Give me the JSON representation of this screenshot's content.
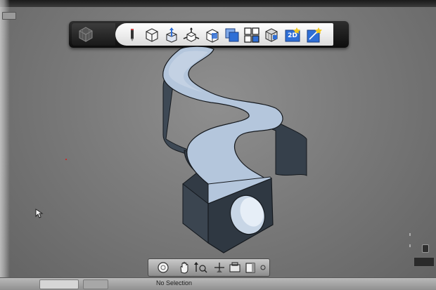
{
  "window": {
    "close_icon": "close-window-icon"
  },
  "toolbar": {
    "buttons": [
      {
        "name": "view-cube-icon"
      },
      {
        "name": "sketch-pencil-icon"
      },
      {
        "name": "box-primitive-icon"
      },
      {
        "name": "push-pull-icon"
      },
      {
        "name": "move-icon"
      },
      {
        "name": "modify-icon"
      },
      {
        "name": "combine-icon"
      },
      {
        "name": "pattern-icon"
      },
      {
        "name": "grouping-icon"
      },
      {
        "name": "2d-icon",
        "label": "2D"
      },
      {
        "name": "measure-icon"
      }
    ]
  },
  "navbar": {
    "buttons": [
      {
        "name": "orbit-icon"
      },
      {
        "name": "pan-hand-icon"
      },
      {
        "name": "zoom-icon"
      },
      {
        "name": "look-at-icon"
      },
      {
        "name": "fit-all-icon"
      },
      {
        "name": "view-style-icon"
      }
    ]
  },
  "status": {
    "selection_text": "No Selection"
  },
  "colors": {
    "viewport_bg": "#7a7a7a",
    "model_top": "#b4c6dc",
    "model_side": "#3e4955",
    "model_front": "#2c343d",
    "toolbar_dark": "#1a1a1a",
    "accent_blue": "#2f6fd6"
  }
}
